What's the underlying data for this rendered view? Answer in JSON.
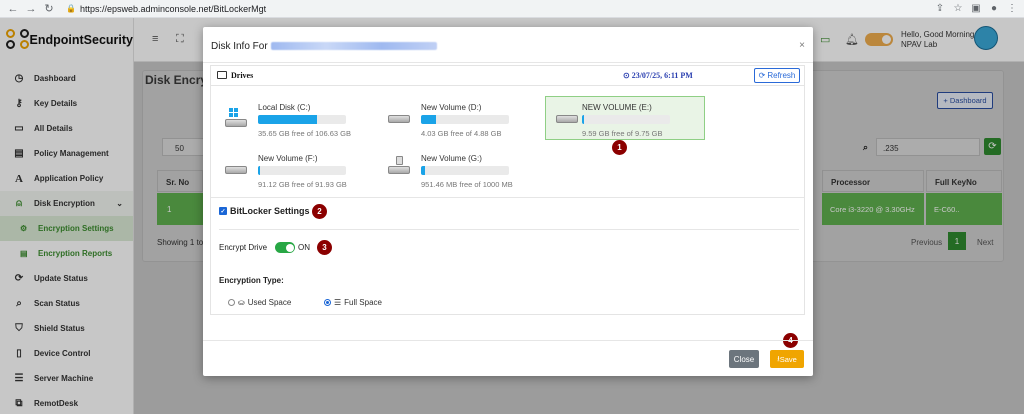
{
  "browser": {
    "url": "https://epsweb.adminconsole.net/BitLockerMgt"
  },
  "brand": {
    "name": "EndpointSecurity"
  },
  "sidebar": {
    "items": [
      {
        "label": "Dashboard",
        "icon": "dashboard-icon"
      },
      {
        "label": "Key Details",
        "icon": "key-icon"
      },
      {
        "label": "All Details",
        "icon": "monitor-icon"
      },
      {
        "label": "Policy Management",
        "icon": "document-icon"
      },
      {
        "label": "Application Policy",
        "icon": "letter-a-icon"
      },
      {
        "label": "Disk Encryption",
        "icon": "lock-icon"
      },
      {
        "label": "Encryption Settings",
        "icon": "gear-icon"
      },
      {
        "label": "Encryption Reports",
        "icon": "report-icon"
      },
      {
        "label": "Update Status",
        "icon": "refresh-icon"
      },
      {
        "label": "Scan Status",
        "icon": "search-icon"
      },
      {
        "label": "Shield Status",
        "icon": "shield-icon"
      },
      {
        "label": "Device Control",
        "icon": "device-icon"
      },
      {
        "label": "Server Machine",
        "icon": "server-icon"
      },
      {
        "label": "RemotDesk",
        "icon": "remote-desktop-icon"
      }
    ]
  },
  "topbar": {
    "greeting_line1": "Hello, Good Morning",
    "greeting_line2": "NPAV Lab"
  },
  "background": {
    "page_title": "Disk Encryp",
    "dashboard_btn": "+ Dashboard",
    "page_size": "50",
    "search_value": ".235",
    "col_sr_no": "Sr. No",
    "col_processor": "Processor",
    "col_full_key": "Full KeyNo",
    "row_sr": "1",
    "row_processor": "Core i3-3220 @ 3.30GHz",
    "row_key": "E-C60..",
    "showing": "Showing 1 to",
    "prev": "Previous",
    "page": "1",
    "next": "Next"
  },
  "modal": {
    "title": "Disk Info For",
    "close_symbol": "×",
    "drives_label": "Drives",
    "datetime": "23/07/25, 6:11 PM",
    "refresh_label": "Refresh",
    "drives": [
      {
        "name": "Local Disk (C:)",
        "free": "35.65 GB free of 106.63 GB",
        "used_fraction": 0.666,
        "type": "windows"
      },
      {
        "name": "New Volume (D:)",
        "free": "4.03 GB free of 4.88 GB",
        "used_fraction": 0.174,
        "type": "hdd"
      },
      {
        "name": "NEW VOLUME (E:)",
        "free": "9.59 GB free of 9.75 GB",
        "used_fraction": 0.016,
        "type": "hdd",
        "selected": true
      },
      {
        "name": "New Volume (F:)",
        "free": "91.12 GB free of 91.93 GB",
        "used_fraction": 0.009,
        "type": "hdd"
      },
      {
        "name": "New Volume (G:)",
        "free": "951.46 MB free of 1000 MB",
        "used_fraction": 0.049,
        "type": "usb"
      }
    ],
    "bitlocker_label": "BitLocker Settings",
    "encrypt_drive_label": "Encrypt Drive",
    "encrypt_state": "ON",
    "encryption_type_label": "Encryption Type:",
    "used_space_label": "Used Space",
    "full_space_label": "Full Space",
    "close_btn": "Close",
    "save_btn": "Save"
  },
  "callouts": [
    "1",
    "2",
    "3",
    "4"
  ],
  "colors": {
    "accent_green": "#3c8d2f",
    "callout": "#8b0000",
    "save": "#f0a500",
    "progress": "#1aa3e8"
  }
}
